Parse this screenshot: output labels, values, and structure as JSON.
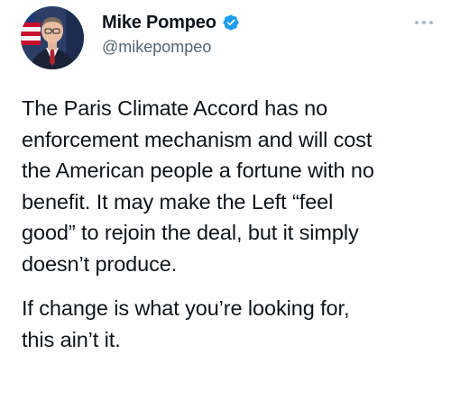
{
  "tweet": {
    "author": {
      "display_name": "Mike Pompeo",
      "handle": "@mikepompeo",
      "verified": true,
      "avatar_icon": "avatar-photo"
    },
    "more_icon": "more-options-icon",
    "paragraphs": [
      {
        "lines": [
          "The Paris Climate Accord has no",
          "enforcement mechanism and will cost",
          "the American people a fortune with no",
          "benefit. It may make the Left “feel",
          "good” to rejoin the deal, but it simply",
          "doesn’t produce."
        ]
      },
      {
        "lines": [
          "If change is what you’re looking for,",
          "this ain’t it."
        ]
      }
    ]
  },
  "colors": {
    "text": "#0f1419",
    "secondary_text": "#536471",
    "verified_badge": "#1d9bf0"
  }
}
